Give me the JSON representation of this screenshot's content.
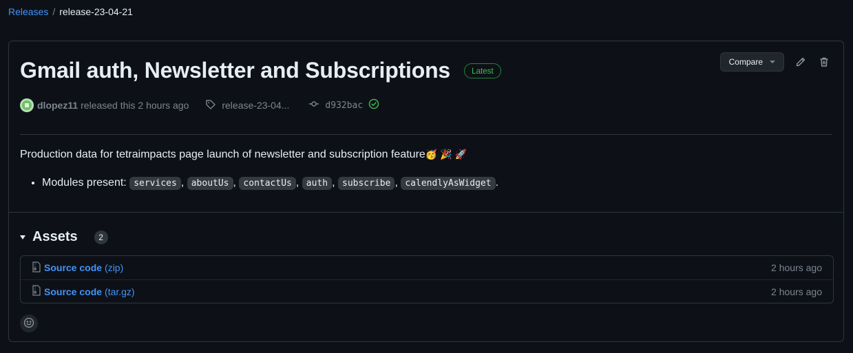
{
  "breadcrumb": {
    "root": "Releases",
    "separator": "/",
    "current": "release-23-04-21"
  },
  "release": {
    "title": "Gmail auth, Newsletter and Subscriptions",
    "badge": "Latest",
    "author": "dlopez11",
    "released_text": "released this 2 hours ago",
    "tag": "release-23-04...",
    "commit": "d932bac"
  },
  "actions": {
    "compare_label": "Compare"
  },
  "description": {
    "text": "Production data for tetraimpacts page launch of newsletter and subscription feature",
    "emojis": "🥳 🎉 🚀",
    "modules_label": "Modules present: ",
    "modules": [
      "services",
      "aboutUs",
      "contactUs",
      "auth",
      "subscribe",
      "calendlyAsWidget"
    ],
    "separator": ",",
    "end": "."
  },
  "assets": {
    "title": "Assets",
    "count": "2",
    "items": [
      {
        "name": "Source code",
        "type": "(zip)",
        "time": "2 hours ago"
      },
      {
        "name": "Source code",
        "type": "(tar.gz)",
        "time": "2 hours ago"
      }
    ]
  },
  "colors": {
    "background": "#0d1117",
    "link": "#4493f8",
    "success": "#3fb950",
    "border": "#30363d"
  },
  "icons": [
    "tag-icon",
    "git-commit-icon",
    "verified-check-icon",
    "pencil-icon",
    "trash-icon",
    "file-zip-icon",
    "smiley-icon"
  ]
}
